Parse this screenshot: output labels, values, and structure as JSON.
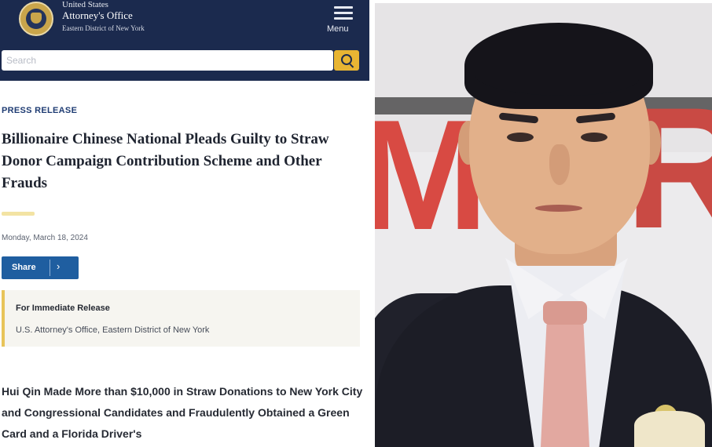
{
  "header": {
    "org_line1": "United States",
    "org_line2": "Attorney's Office",
    "org_line3": "Eastern District of New York",
    "menu_label": "Menu"
  },
  "search": {
    "placeholder": "Search"
  },
  "article": {
    "eyebrow": "PRESS RELEASE",
    "title": "Billionaire Chinese National Pleads Guilty to Straw Donor Campaign Contribution Scheme and Other Frauds",
    "date": "Monday, March 18, 2024",
    "share_label": "Share",
    "share_chevron": "›",
    "release_title": "For Immediate Release",
    "release_office": "U.S. Attorney's Office, Eastern District of New York",
    "subhead": "Hui Qin Made More than $10,000 in Straw Donations to New York City and Congressional Candidates and Fraudulently Obtained a Green Card and a Florida Driver's"
  },
  "photo": {
    "backdrop_letters_left": "M",
    "backdrop_letters_right": "R"
  },
  "colors": {
    "header_navy": "#1b2a4e",
    "search_button_gold": "#e8b533",
    "share_blue": "#1f5ea0",
    "accent_yellow": "#e8c45a",
    "backdrop_red": "#d84a43"
  },
  "icons": [
    "seal-icon",
    "menu-icon",
    "search-icon",
    "chevron-right-icon"
  ]
}
